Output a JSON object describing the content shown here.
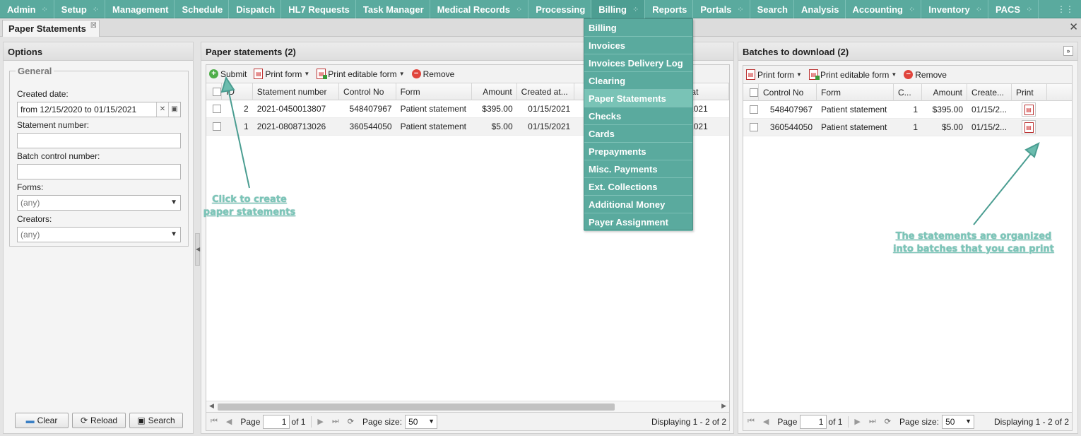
{
  "menu": {
    "items": [
      {
        "label": "Admin",
        "grip": true
      },
      {
        "label": "Setup",
        "grip": true
      },
      {
        "label": "Management",
        "grip": false
      },
      {
        "label": "Schedule",
        "grip": false
      },
      {
        "label": "Dispatch",
        "grip": false
      },
      {
        "label": "HL7 Requests",
        "grip": false
      },
      {
        "label": "Task Manager",
        "grip": false
      },
      {
        "label": "Medical Records",
        "grip": true
      },
      {
        "label": "Processing",
        "grip": false
      },
      {
        "label": "Billing",
        "grip": true,
        "active": true
      },
      {
        "label": "Reports",
        "grip": false
      },
      {
        "label": "Portals",
        "grip": true
      },
      {
        "label": "Search",
        "grip": false
      },
      {
        "label": "Analysis",
        "grip": false
      },
      {
        "label": "Accounting",
        "grip": true
      },
      {
        "label": "Inventory",
        "grip": true
      },
      {
        "label": "PACS",
        "grip": true
      }
    ],
    "grip_icon": "drag-dots-icon"
  },
  "billing_dropdown": {
    "items": [
      "Billing",
      "Invoices",
      "Invoices Delivery Log",
      "Clearing",
      "Paper Statements",
      "Checks",
      "Cards",
      "Prepayments",
      "Misc. Payments",
      "Ext. Collections",
      "Additional Money",
      "Payer Assignment"
    ],
    "highlighted": "Paper Statements"
  },
  "tab": {
    "title": "Paper Statements"
  },
  "options": {
    "title": "Options",
    "legend": "General",
    "created_date_label": "Created date:",
    "created_date_value": "from 12/15/2020 to 01/15/2021",
    "statement_number_label": "Statement number:",
    "batch_control_label": "Batch control number:",
    "forms_label": "Forms:",
    "forms_value": "(any)",
    "creators_label": "Creators:",
    "creators_value": "(any)",
    "clear_label": "Clear",
    "reload_label": "Reload",
    "search_label": "Search"
  },
  "statements": {
    "title": "Paper statements (2)",
    "toolbar": {
      "submit": "Submit",
      "print_form": "Print form",
      "print_editable": "Print editable form",
      "remove": "Remove"
    },
    "columns": [
      "ID",
      "Statement number",
      "Control No",
      "Form",
      "Amount",
      "Created at...",
      "ent at"
    ],
    "rows": [
      {
        "id": "2",
        "statement_number": "2021-0450013807",
        "control_no": "548407967",
        "form": "Patient statement",
        "amount": "$395.00",
        "created": "01/15/2021",
        "sent": "15/2021"
      },
      {
        "id": "1",
        "statement_number": "2021-0808713026",
        "control_no": "360544050",
        "form": "Patient statement",
        "amount": "$5.00",
        "created": "01/15/2021",
        "sent": "15/2021"
      }
    ],
    "pager": {
      "page_label": "Page",
      "page": "1",
      "of": "of 1",
      "size_label": "Page size:",
      "size": "50",
      "display": "Displaying 1 - 2 of 2"
    }
  },
  "batches": {
    "title": "Batches to download (2)",
    "toolbar": {
      "print_form": "Print form",
      "print_editable": "Print editable form",
      "remove": "Remove"
    },
    "columns": [
      "Control No",
      "Form",
      "C...",
      "Amount",
      "Create...",
      "Print"
    ],
    "rows": [
      {
        "control_no": "548407967",
        "form": "Patient statement",
        "count": "1",
        "amount": "$395.00",
        "created": "01/15/2..."
      },
      {
        "control_no": "360544050",
        "form": "Patient statement",
        "count": "1",
        "amount": "$5.00",
        "created": "01/15/2..."
      }
    ],
    "pager": {
      "page_label": "Page",
      "page": "1",
      "of": "of 1",
      "size_label": "Page size:",
      "size": "50",
      "display": "Displaying 1 - 2 of 2"
    }
  },
  "annotations": {
    "submit_line1": "Click to create",
    "submit_line2": "paper statements",
    "batches_line1": "The statements are organized",
    "batches_line2": "into batches that you can print"
  },
  "colors": {
    "menu_bg": "#5aaa9e",
    "menu_highlight": "#79c3b6",
    "annotation": "#7cc6b9"
  }
}
